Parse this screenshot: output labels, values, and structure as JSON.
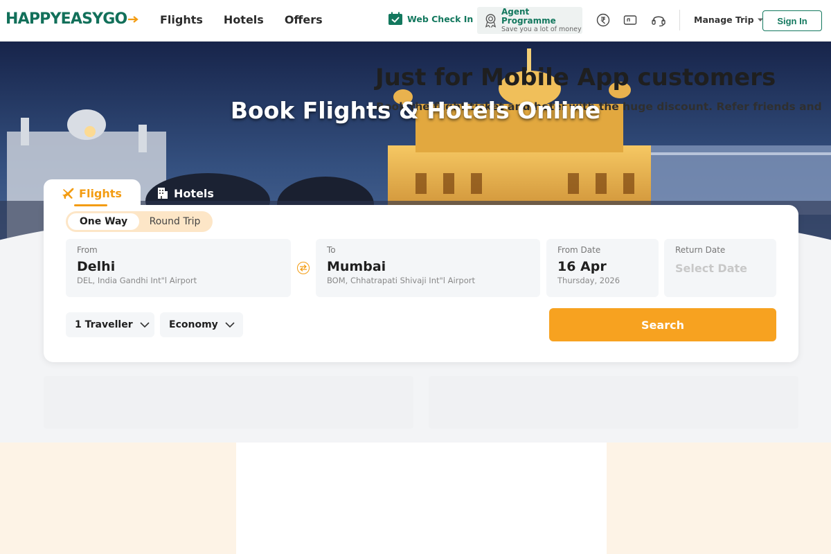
{
  "brand": {
    "logo_text": "HAPPYEASYG",
    "logo_accent": "O",
    "brand_color": "#12705a",
    "accent_color": "#f7a220"
  },
  "header": {
    "nav": [
      "Flights",
      "Hotels",
      "Offers"
    ],
    "web_check_in": "Web Check In",
    "agent_title": "Agent Programme",
    "agent_sub": "Save you a lot of money",
    "icons": [
      "rupee-icon",
      "wallet-icon",
      "headset-icon"
    ],
    "manage_trip": "Manage Trip",
    "sign_in": "Sign In"
  },
  "hero": {
    "title": "Book Flights & Hotels Online"
  },
  "search": {
    "tabs": [
      "Flights",
      "Hotels"
    ],
    "active_tab": "Flights",
    "trip_types": [
      "One Way",
      "Round Trip"
    ],
    "active_trip_type": "One Way",
    "from": {
      "label": "From",
      "city": "Delhi",
      "airport": "DEL, India Gandhi Int\"l Airport"
    },
    "to": {
      "label": "To",
      "city": "Mumbai",
      "airport": "BOM, Chhatrapati Shivaji Int\"l Airport"
    },
    "from_date": {
      "label": "From Date",
      "value": "16 Apr",
      "sub": "Thursday, 2026"
    },
    "return_date": {
      "label": "Return Date",
      "placeholder": "Select Date"
    },
    "travellers": "1 Traveller",
    "cabin": "Economy",
    "button": "Search"
  },
  "app_promo": {
    "title": "Just for Mobile App customers",
    "text": "Book the flight ticket and hotel with the huge discount. Refer friends and"
  }
}
